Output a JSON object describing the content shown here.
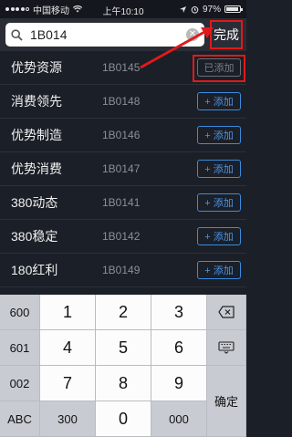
{
  "status_bar": {
    "carrier": "中国移动",
    "time": "上午10:10",
    "battery": "97%"
  },
  "search": {
    "value": "1B014",
    "done_label": "完成"
  },
  "list": [
    {
      "name": "优势资源",
      "code": "1B0145",
      "action": "已添加"
    },
    {
      "name": "消费领先",
      "code": "1B0148",
      "action": "+ 添加"
    },
    {
      "name": "优势制造",
      "code": "1B0146",
      "action": "+ 添加"
    },
    {
      "name": "优势消费",
      "code": "1B0147",
      "action": "+ 添加"
    },
    {
      "name": "380动态",
      "code": "1B0141",
      "action": "+ 添加"
    },
    {
      "name": "380稳定",
      "code": "1B0142",
      "action": "+ 添加"
    },
    {
      "name": "180红利",
      "code": "1B0149",
      "action": "+ 添加"
    }
  ],
  "keyboard": {
    "k600": "600",
    "k1": "1",
    "k2": "2",
    "k3": "3",
    "k601": "601",
    "k4": "4",
    "k5": "5",
    "k6": "6",
    "k002": "002",
    "k7": "7",
    "k8": "8",
    "k9": "9",
    "confirm": "确定",
    "abc": "ABC",
    "k300": "300",
    "k0": "0",
    "k000": "000"
  },
  "colors": {
    "accent": "#4a95ea",
    "annotation": "#e01a1a",
    "background": "#1b1f27"
  }
}
